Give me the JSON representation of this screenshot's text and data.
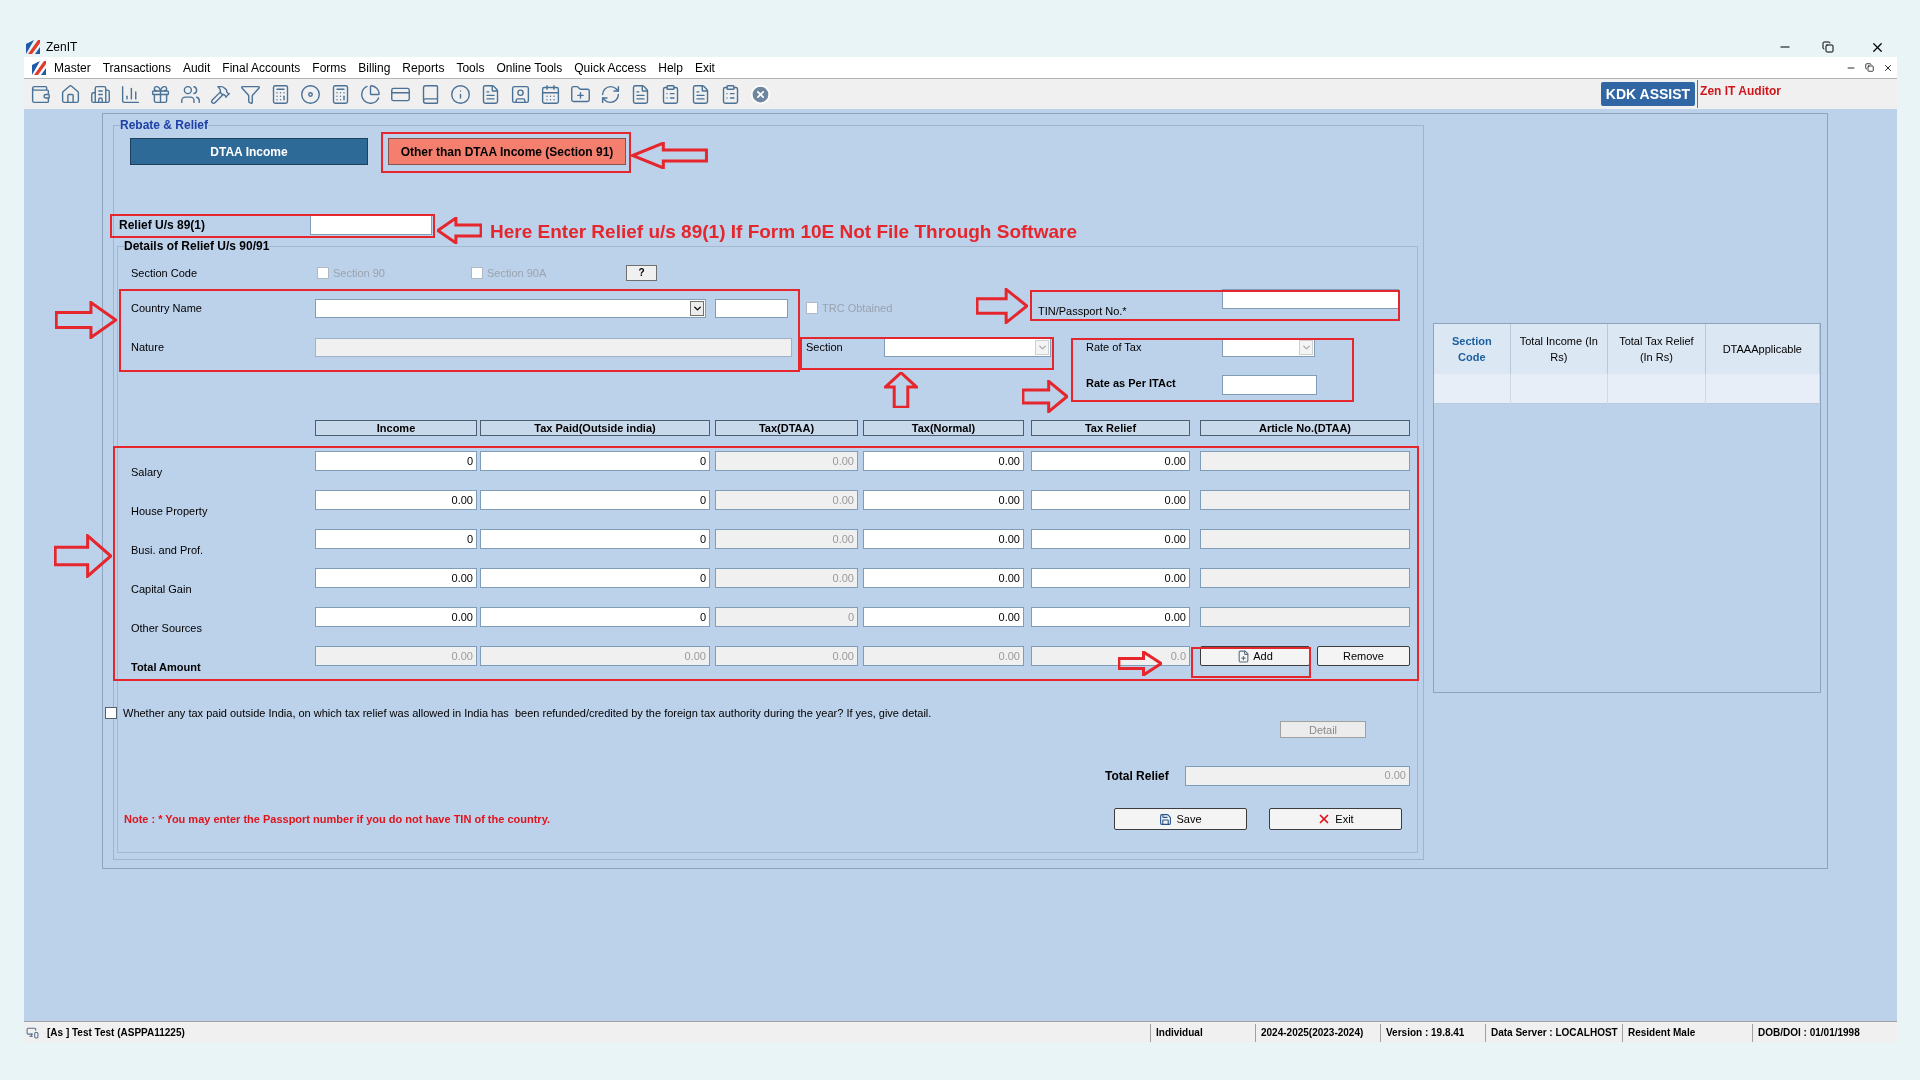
{
  "window": {
    "title": "ZenIT"
  },
  "menu": [
    "Master",
    "Transactions",
    "Audit",
    "Final Accounts",
    "Forms",
    "Billing",
    "Reports",
    "Tools",
    "Online Tools",
    "Quick Access",
    "Help",
    "Exit"
  ],
  "toolbar": {
    "assist": "KDK ASSIST",
    "auditor": "Zen IT Auditor"
  },
  "form": {
    "title": "Rebate & Relief",
    "tabs": [
      {
        "label": "DTAA Income",
        "selected": false
      },
      {
        "label": "Other than DTAA Income (Section 91)",
        "selected": true
      }
    ],
    "relief_89": {
      "label": "Relief U/s 89(1)"
    },
    "annotation": "Here Enter Relief u/s 89(1) If Form 10E Not File Through Software",
    "details": {
      "title": "Details of Relief U/s 90/91",
      "section_code": {
        "label": "Section Code",
        "options": [
          {
            "label": "Section 90",
            "checked": false,
            "disabled": true
          },
          {
            "label": "Section 90A",
            "checked": false,
            "disabled": true
          }
        ],
        "help": "?"
      },
      "country": {
        "label": "Country Name",
        "disabled": false
      },
      "trc": {
        "label": "TRC Obtained",
        "checked": false,
        "disabled": true
      },
      "tin": {
        "label": "TIN/Passport No.*"
      },
      "nature": {
        "label": "Nature",
        "disabled": true
      },
      "section": {
        "label": "Section",
        "disabled": true
      },
      "rate_of_tax": {
        "label": "Rate of Tax",
        "disabled": true
      },
      "rate_itact": {
        "label": "Rate as Per ITAct"
      },
      "columns": [
        {
          "label": "Income",
          "disabled": false
        },
        {
          "label": "Tax Paid(Outside india)",
          "disabled": false
        },
        {
          "label": "Tax(DTAA)",
          "disabled": true
        },
        {
          "label": "Tax(Normal)",
          "disabled": false
        },
        {
          "label": "Tax Relief",
          "disabled": false
        },
        {
          "label": "Article No.(DTAA)",
          "disabled": true
        }
      ],
      "rows": [
        {
          "kind": "entry",
          "label": "Salary",
          "cells": [
            "0",
            "0",
            "0.00",
            "0.00",
            "0.00"
          ]
        },
        {
          "kind": "entry",
          "label": "House Property",
          "cells": [
            "0.00",
            "0",
            "0.00",
            "0.00",
            "0.00"
          ]
        },
        {
          "kind": "entry",
          "label": "Busi. and Prof.",
          "cells": [
            "0",
            "0",
            "0.00",
            "0.00",
            "0.00"
          ]
        },
        {
          "kind": "entry",
          "label": "Capital Gain",
          "cells": [
            "0.00",
            "0",
            "0.00",
            "0.00",
            "0.00"
          ]
        },
        {
          "kind": "entry",
          "label": "Other Sources",
          "cells": [
            "0.00",
            "0",
            "0",
            "0.00",
            "0.00"
          ]
        },
        {
          "kind": "total",
          "label": "Total Amount",
          "cells": [
            "0.00",
            "0.00",
            "0.00",
            "0.00",
            "0.0"
          ]
        }
      ],
      "add": "Add",
      "remove": "Remove",
      "refund": {
        "label": "Whether any tax paid outside India, on which tax relief was allowed in India has  been refunded/credited by the foreign tax authority during the year? If yes, give detail.",
        "checked": false
      },
      "detail": {
        "label": "Detail",
        "disabled": true
      },
      "total_relief": {
        "label": "Total Relief",
        "value": "0.00"
      },
      "note": "Note : * You may enter the Passport number if you do not have TIN of the country.",
      "save": "Save",
      "exit": "Exit"
    }
  },
  "summary_table": {
    "columns": [
      "Section Code",
      "Total Income (In Rs)",
      "Total Tax Relief (In Rs)",
      "DTAAApplicable"
    ]
  },
  "status_bar": {
    "user": "[As ] Test Test (ASPPA11225)",
    "items": [
      "Individual",
      "2024-2025(2023-2024)",
      "Version : 19.8.41",
      "Data Server : LOCALHOST",
      "Resident Male",
      "DOB/DOI : 01/01/1998"
    ]
  }
}
